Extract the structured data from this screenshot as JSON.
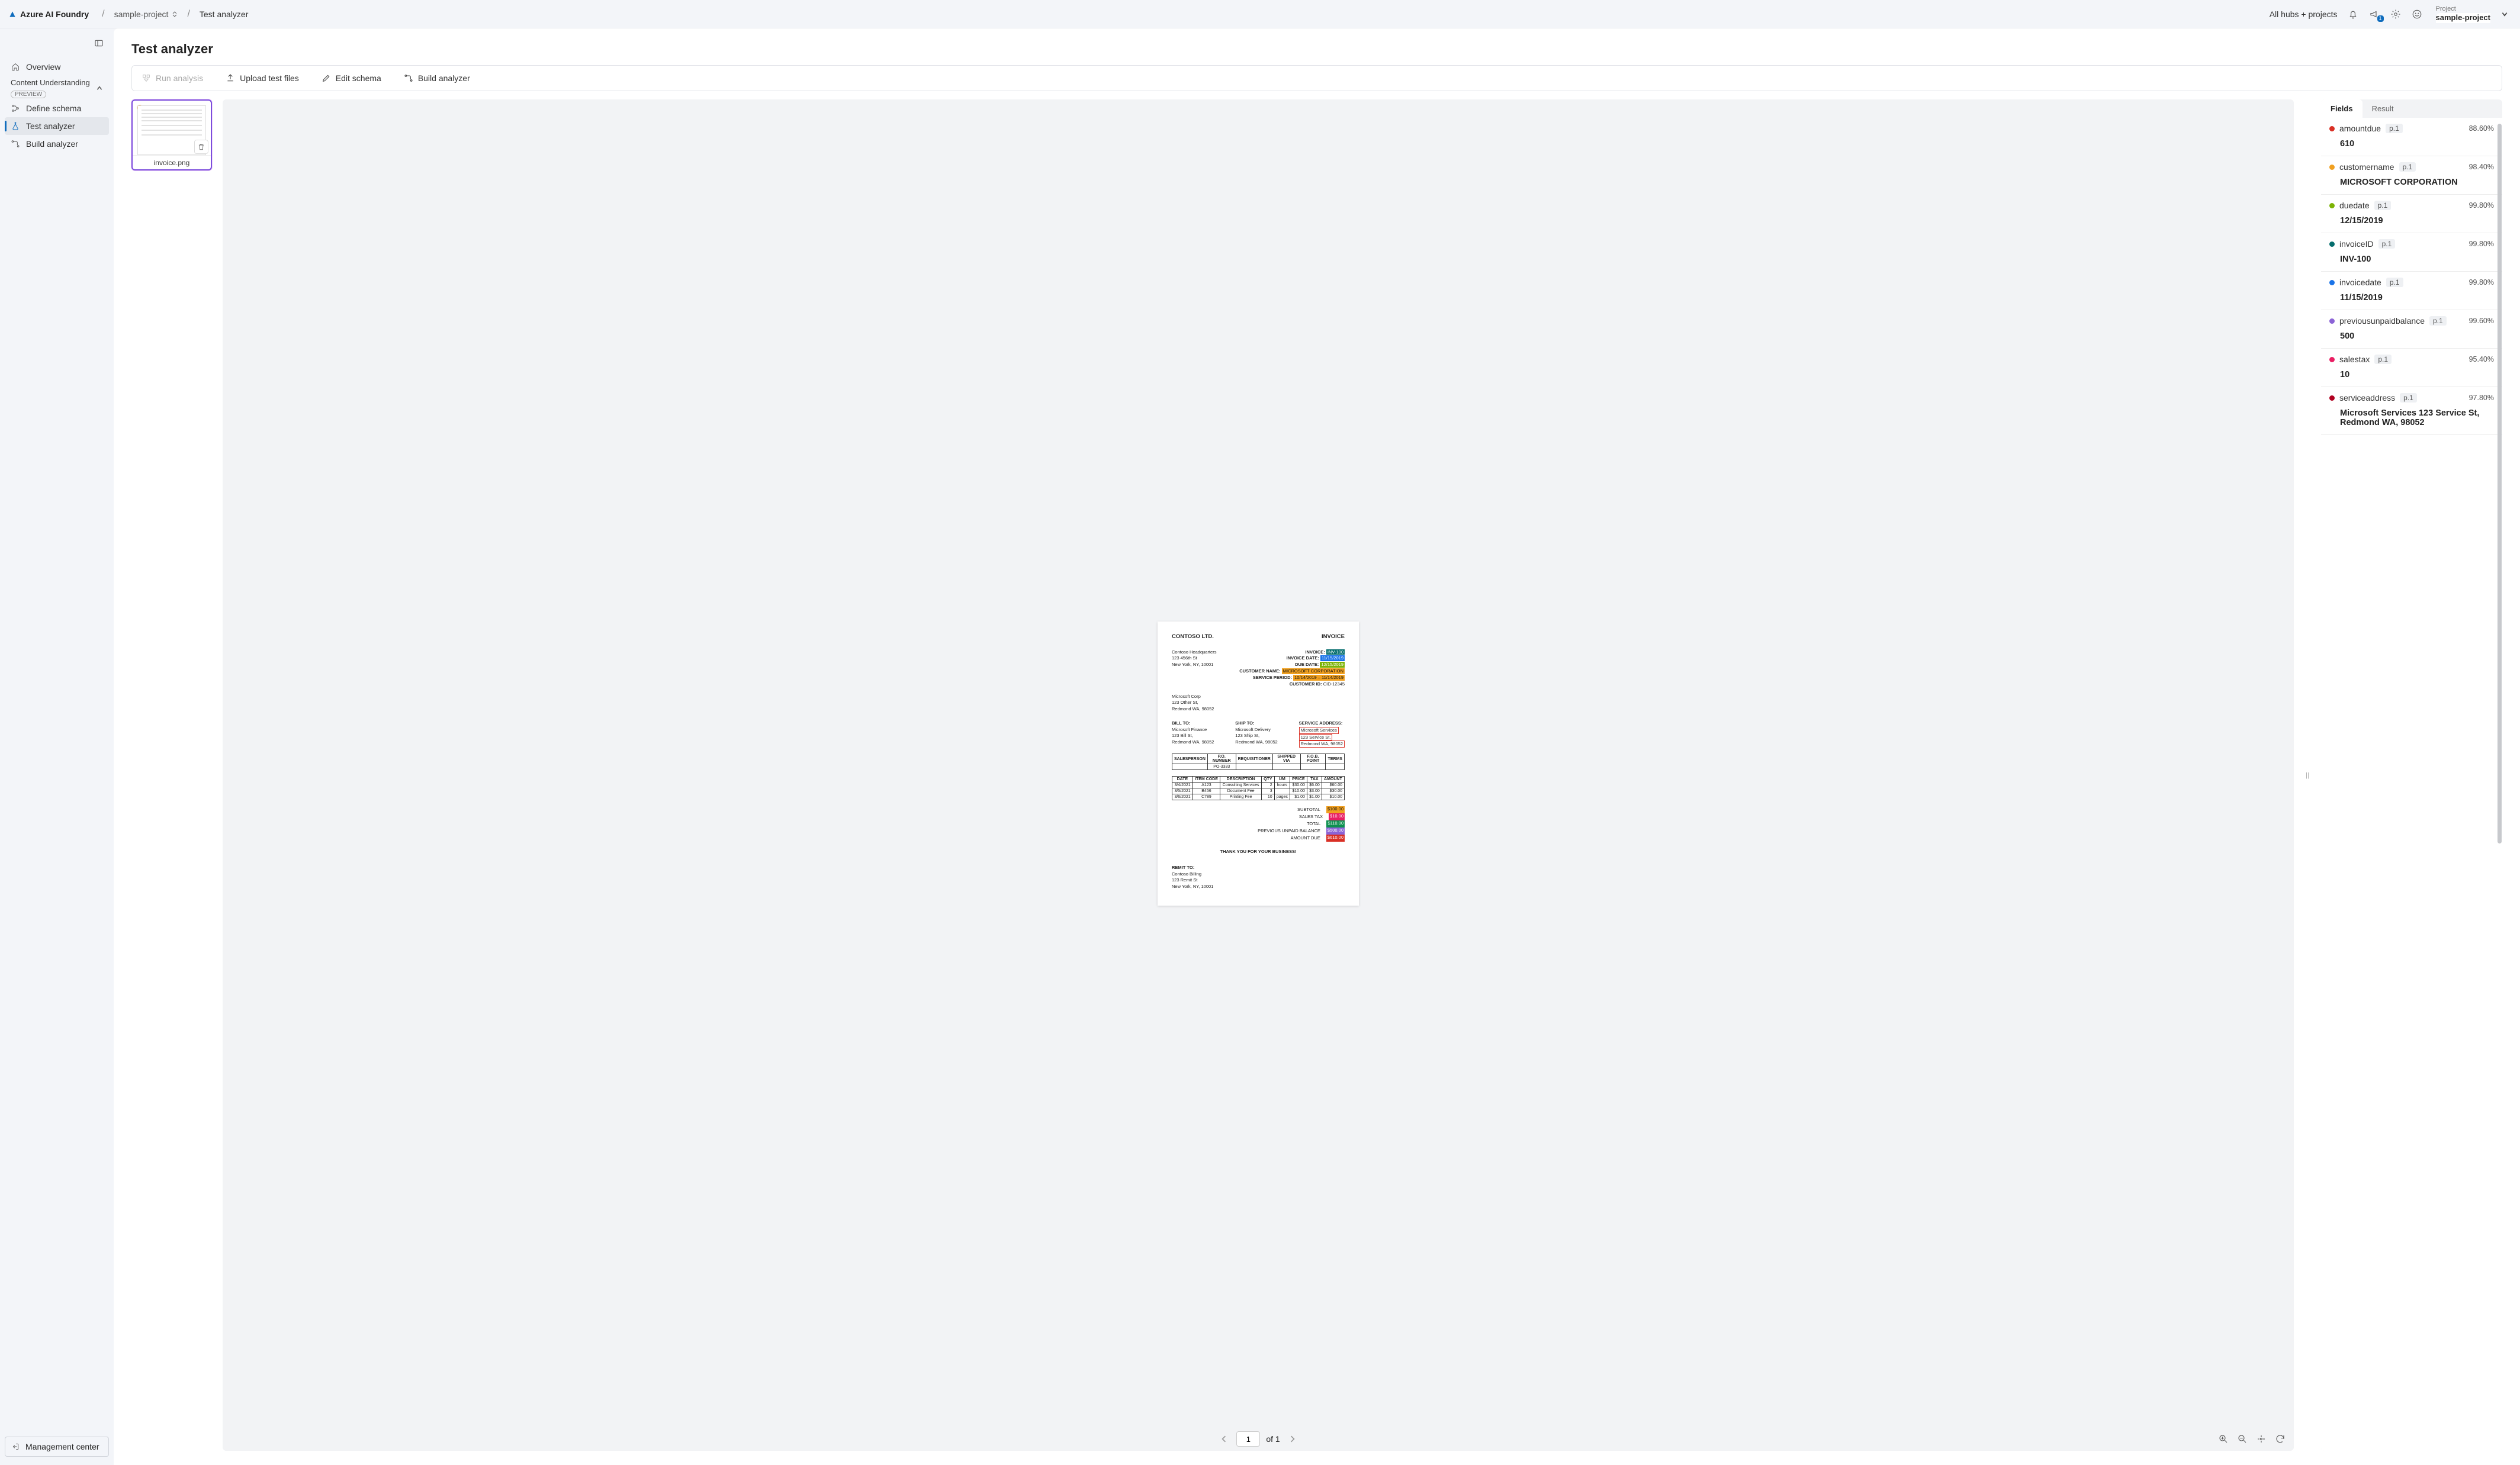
{
  "header": {
    "brand": "Azure AI Foundry",
    "project": "sample-project",
    "page": "Test analyzer",
    "all_hubs": "All hubs + projects",
    "announce_badge": "1",
    "project_label": "Project",
    "project_name": "sample-project"
  },
  "sidebar": {
    "overview": "Overview",
    "section": "Content Understanding",
    "preview": "PREVIEW",
    "define": "Define schema",
    "test": "Test analyzer",
    "build": "Build analyzer",
    "mgmt": "Management center"
  },
  "page_title": "Test analyzer",
  "toolbar": {
    "run": "Run analysis",
    "upload": "Upload test files",
    "edit": "Edit schema",
    "build": "Build analyzer"
  },
  "thumb": {
    "caption": "invoice.png"
  },
  "doc": {
    "company": "CONTOSO LTD.",
    "invoice_lbl": "INVOICE",
    "hq": {
      "l1": "Contoso Headquarters",
      "l2": "123 456th St",
      "l3": "New York, NY, 10001"
    },
    "right": {
      "invoice_k": "INVOICE:",
      "invoice_v": "INV-100",
      "invdate_k": "INVOICE DATE:",
      "invdate_v": "11/15/2019",
      "duedate_k": "DUE DATE:",
      "duedate_v": "12/15/2019",
      "cust_k": "CUSTOMER NAME:",
      "cust_v": "MICROSOFT CORPORATION",
      "period_k": "SERVICE PERIOD:",
      "period_v": "10/14/2019 – 11/14/2019",
      "cid_k": "CUSTOMER ID:",
      "cid_v": "CID-12345"
    },
    "blk1": {
      "l1": "Microsoft Corp",
      "l2": "123 Other St,",
      "l3": "Redmond WA, 98052"
    },
    "bill": {
      "h": "BILL TO:",
      "l1": "Microsoft Finance",
      "l2": "123 Bill St,",
      "l3": "Redmond WA, 98052"
    },
    "ship": {
      "h": "SHIP TO:",
      "l1": "Microsoft Delivery",
      "l2": "123 Ship St,",
      "l3": "Redmond WA, 98052"
    },
    "svc": {
      "h": "SERVICE ADDRESS:",
      "l1": "Microsoft Services",
      "l2": "123 Service St,",
      "l3": "Redmond WA, 98052"
    },
    "tab1_h": [
      "SALESPERSON",
      "P.O. NUMBER",
      "REQUISITIONER",
      "SHIPPED VIA",
      "F.O.B. POINT",
      "TERMS"
    ],
    "tab1_r": [
      "",
      "PO-3333",
      "",
      "",
      "",
      ""
    ],
    "tab2_h": [
      "DATE",
      "ITEM CODE",
      "DESCRIPTION",
      "QTY",
      "UM",
      "PRICE",
      "TAX",
      "AMOUNT"
    ],
    "tab2_r": [
      [
        "3/4/2021",
        "A123",
        "Consulting Services",
        "2",
        "hours",
        "$30.00",
        "$6.00",
        "$60.00"
      ],
      [
        "3/5/2021",
        "B456",
        "Document Fee",
        "3",
        "",
        "$10.00",
        "$3.00",
        "$30.00"
      ],
      [
        "3/6/2021",
        "C789",
        "Printing Fee",
        "10",
        "pages",
        "$1.00",
        "$1.00",
        "$10.00"
      ]
    ],
    "totals": {
      "subtotal_k": "SUBTOTAL",
      "subtotal_v": "$100.00",
      "tax_k": "SALES TAX",
      "tax_v": "$10.00",
      "total_k": "TOTAL",
      "total_v": "$110.00",
      "prev_k": "PREVIOUS UNPAID BALANCE",
      "prev_v": "$500.00",
      "due_k": "AMOUNT DUE",
      "due_v": "$610.00"
    },
    "thanks": "THANK YOU FOR YOUR BUSINESS!",
    "remit": {
      "h": "REMIT TO:",
      "l1": "Contoso Billing",
      "l2": "123 Remit St",
      "l3": "New York, NY, 10001"
    }
  },
  "pager": {
    "current": "1",
    "of_label": "of 1"
  },
  "tabs": {
    "fields": "Fields",
    "result": "Result"
  },
  "fields": [
    {
      "color": "#d93025",
      "name": "amountdue",
      "page": "p.1",
      "conf": "88.60%",
      "value": "610"
    },
    {
      "color": "#f0a020",
      "name": "customername",
      "page": "p.1",
      "conf": "98.40%",
      "value": "MICROSOFT CORPORATION"
    },
    {
      "color": "#7cb305",
      "name": "duedate",
      "page": "p.1",
      "conf": "99.80%",
      "value": "12/15/2019"
    },
    {
      "color": "#046d6d",
      "name": "invoiceID",
      "page": "p.1",
      "conf": "99.80%",
      "value": "INV-100"
    },
    {
      "color": "#1a73e8",
      "name": "invoicedate",
      "page": "p.1",
      "conf": "99.80%",
      "value": "11/15/2019"
    },
    {
      "color": "#8b63d6",
      "name": "previousunpaidbalance",
      "page": "p.1",
      "conf": "99.60%",
      "value": "500"
    },
    {
      "color": "#e91e63",
      "name": "salestax",
      "page": "p.1",
      "conf": "95.40%",
      "value": "10"
    },
    {
      "color": "#b00020",
      "name": "serviceaddress",
      "page": "p.1",
      "conf": "97.80%",
      "value": "Microsoft Services 123 Service St, Redmond WA, 98052"
    }
  ]
}
